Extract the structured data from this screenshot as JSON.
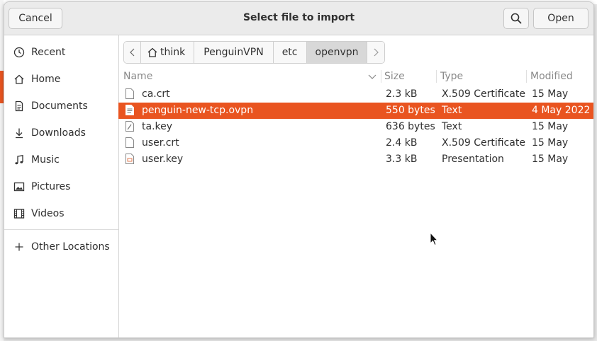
{
  "header": {
    "title": "Select file to import",
    "cancel_label": "Cancel",
    "open_label": "Open",
    "search_icon": "search-icon"
  },
  "sidebar": {
    "items": [
      {
        "label": "Recent",
        "icon": "clock-icon"
      },
      {
        "label": "Home",
        "icon": "home-icon"
      },
      {
        "label": "Documents",
        "icon": "document-icon"
      },
      {
        "label": "Downloads",
        "icon": "download-icon"
      },
      {
        "label": "Music",
        "icon": "music-icon"
      },
      {
        "label": "Pictures",
        "icon": "picture-icon"
      },
      {
        "label": "Videos",
        "icon": "video-icon"
      }
    ],
    "other_locations": {
      "label": "Other Locations",
      "icon": "plus-icon"
    }
  },
  "pathbar": {
    "crumbs": [
      "think",
      "PenguinVPN",
      "etc",
      "openvpn"
    ],
    "active": "openvpn"
  },
  "list": {
    "columns": [
      "Name",
      "Size",
      "Type",
      "Modified"
    ],
    "rows": [
      {
        "name": "ca.crt",
        "size": "2.3 kB",
        "type": "X.509 Certificate",
        "modified": "15 May",
        "selected": false
      },
      {
        "name": "penguin-new-tcp.ovpn",
        "size": "550 bytes",
        "type": "Text",
        "modified": "4 May 2022",
        "selected": true
      },
      {
        "name": "ta.key",
        "size": "636 bytes",
        "type": "Text",
        "modified": "15 May",
        "selected": false
      },
      {
        "name": "user.crt",
        "size": "2.4 kB",
        "type": "X.509 Certificate",
        "modified": "15 May",
        "selected": false
      },
      {
        "name": "user.key",
        "size": "3.3 kB",
        "type": "Presentation",
        "modified": "15 May",
        "selected": false
      }
    ]
  },
  "colors": {
    "accent": "#e95420"
  }
}
